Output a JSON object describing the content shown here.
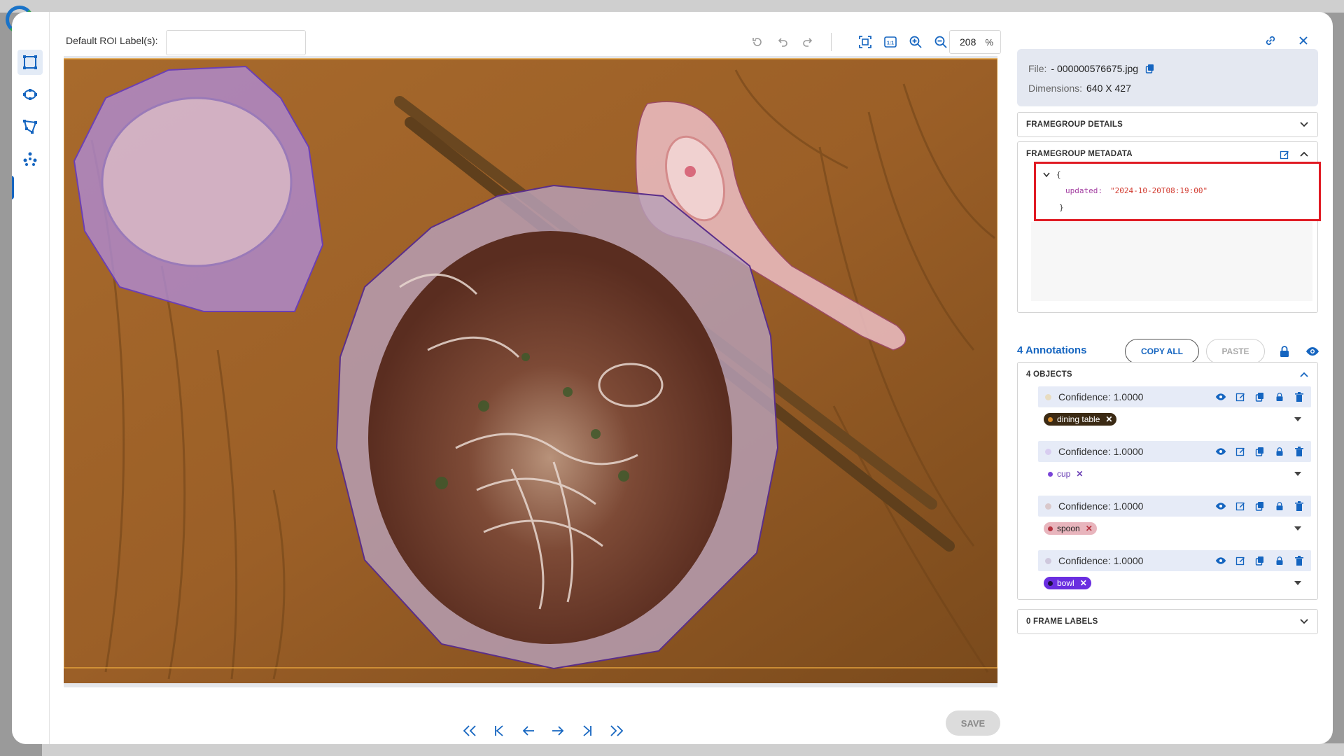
{
  "toolbar": {
    "roi_label": "Default ROI Label(s):",
    "roi_value": "",
    "zoom_value": "208",
    "zoom_unit": "%"
  },
  "file_info": {
    "file_label": "File:",
    "file_value": "- 000000576675.jpg",
    "dimensions_label": "Dimensions:",
    "dimensions_value": "640 X 427"
  },
  "framegroup_details": {
    "title": "FRAMEGROUP DETAILS"
  },
  "framegroup_metadata": {
    "title": "FRAMEGROUP METADATA",
    "json_open": "{",
    "json_key": "updated:",
    "json_value": "\"2024-10-20T08:19:00\"",
    "json_close": "}"
  },
  "annotations": {
    "count_label": "4 Annotations",
    "copy_all": "COPY ALL",
    "paste": "PASTE"
  },
  "objects_section": {
    "title": "4 OBJECTS",
    "items": [
      {
        "confidence": "Confidence: 1.0000",
        "label": "dining table",
        "tag_bg": "#3b2a14",
        "tag_fg": "#ffffff",
        "dot": "#d98c2b",
        "status_dot": "#e8dcc0"
      },
      {
        "confidence": "Confidence: 1.0000",
        "label": "cup",
        "tag_bg": "#ffffff",
        "tag_fg": "#6a3fb5",
        "dot": "#7a44d8",
        "status_dot": "#d8cdf0"
      },
      {
        "confidence": "Confidence: 1.0000",
        "label": "spoon",
        "tag_bg": "#e8b5bd",
        "tag_fg": "#222222",
        "dot": "#b5323f",
        "status_dot": "#d9c8cb"
      },
      {
        "confidence": "Confidence: 1.0000",
        "label": "bowl",
        "tag_bg": "#6a2ee0",
        "tag_fg": "#ffffff",
        "dot": "#1b1040",
        "status_dot": "#cfc8dd"
      }
    ]
  },
  "frame_labels": {
    "title": "0 FRAME LABELS"
  },
  "save_label": "SAVE",
  "colors": {
    "accent": "#1565c0",
    "highlight_border": "#e01b24",
    "object_header_bg": "#e6ebf7"
  }
}
